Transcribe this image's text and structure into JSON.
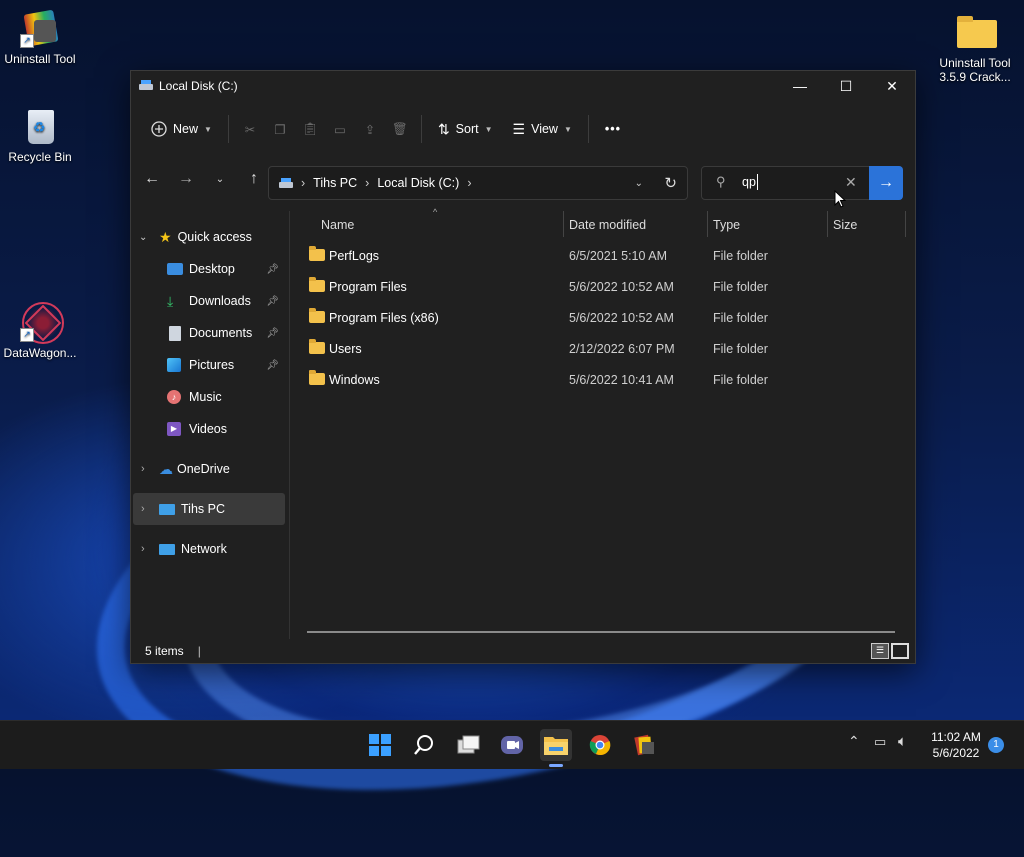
{
  "desktop": {
    "icons": [
      {
        "label": "Uninstall Tool"
      },
      {
        "label": "Recycle Bin"
      },
      {
        "label": "DataWagon..."
      },
      {
        "label_line1": "Uninstall Tool",
        "label_line2": "3.5.9  Crack..."
      }
    ]
  },
  "window": {
    "title": "Local Disk (C:)",
    "controls": {
      "minimize": "—",
      "maximize": "☐",
      "close": "✕"
    }
  },
  "toolbar": {
    "new_label": "New",
    "sort_label": "Sort",
    "view_label": "View",
    "more_label": "•••"
  },
  "address": {
    "crumbs": [
      "Tihs PC",
      "Local Disk (C:)"
    ]
  },
  "search": {
    "value": "qp"
  },
  "sidebar": {
    "quick_access": "Quick access",
    "items": [
      {
        "label": "Desktop",
        "pinned": true
      },
      {
        "label": "Downloads",
        "pinned": true
      },
      {
        "label": "Documents",
        "pinned": true
      },
      {
        "label": "Pictures",
        "pinned": true
      },
      {
        "label": "Music",
        "pinned": false
      },
      {
        "label": "Videos",
        "pinned": false
      }
    ],
    "onedrive": "OneDrive",
    "thispc": "Tihs PC",
    "network": "Network"
  },
  "columns": {
    "name": "Name",
    "date": "Date modified",
    "type": "Type",
    "size": "Size"
  },
  "files": [
    {
      "name": "PerfLogs",
      "date": "6/5/2021 5:10 AM",
      "type": "File folder"
    },
    {
      "name": "Program Files",
      "date": "5/6/2022 10:52 AM",
      "type": "File folder"
    },
    {
      "name": "Program Files (x86)",
      "date": "5/6/2022 10:52 AM",
      "type": "File folder"
    },
    {
      "name": "Users",
      "date": "2/12/2022 6:07 PM",
      "type": "File folder"
    },
    {
      "name": "Windows",
      "date": "5/6/2022 10:41 AM",
      "type": "File folder"
    }
  ],
  "status": {
    "count": "5 items",
    "divider": "|"
  },
  "taskbar": {
    "time": "11:02 AM",
    "date": "5/6/2022",
    "notifications": "1"
  },
  "colors": {
    "accent": "#2b73d9",
    "folder": "#f3c14b",
    "window_bg": "#202020"
  }
}
